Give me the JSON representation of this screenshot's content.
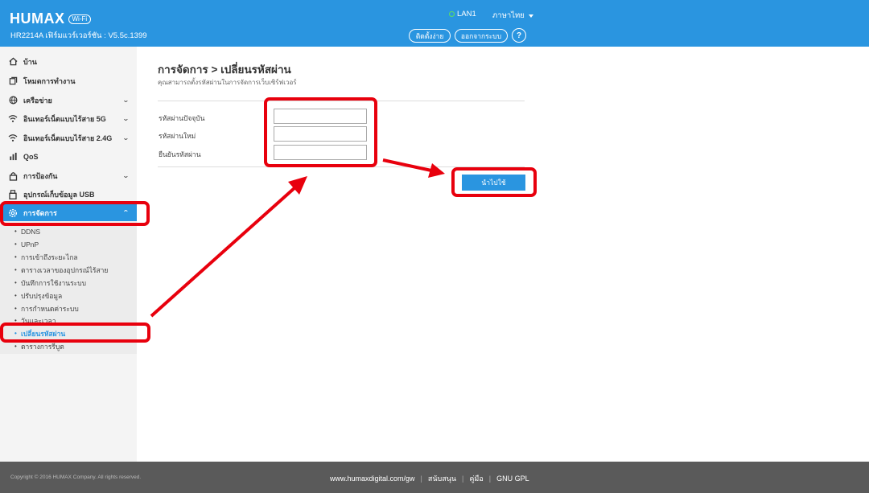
{
  "header": {
    "brand": "HUMAX",
    "wifi_badge": "Wi-Fi",
    "firmware": "HR2214A เฟิร์มแวร์เวอร์ชัน : V5.5c.1399",
    "lan_label": "LAN1",
    "language": "ภาษาไทย",
    "setup_button": "ติดตั้งง่าย",
    "logout_button": "ออกจากระบบ",
    "help_button": "?"
  },
  "sidebar": {
    "items": [
      {
        "label": "บ้าน",
        "icon": "home-icon"
      },
      {
        "label": "โหมดการทำงาน",
        "icon": "mode-icon"
      },
      {
        "label": "เครือข่าย",
        "icon": "globe-icon"
      },
      {
        "label": "อินเทอร์เน็ตแบบไร้สาย 5G",
        "icon": "wifi-icon"
      },
      {
        "label": "อินเทอร์เน็ตแบบไร้สาย 2.4G",
        "icon": "wifi-icon"
      },
      {
        "label": "QoS",
        "icon": "bar-chart-icon"
      },
      {
        "label": "การป้องกัน",
        "icon": "lock-icon"
      },
      {
        "label": "อุปกรณ์เก็บข้อมูล USB",
        "icon": "usb-icon"
      },
      {
        "label": "การจัดการ",
        "icon": "gear-icon"
      }
    ],
    "subitems": [
      "DDNS",
      "UPnP",
      "การเข้าถึงระยะไกล",
      "ตารางเวลาของอุปกรณ์ไร้สาย",
      "บันทึกการใช้งานระบบ",
      "ปรับปรุงข้อมูล",
      "การกำหนดค่าระบบ",
      "วันและเวลา",
      "เปลี่ยนรหัสผ่าน",
      "ตารางการรีบูต"
    ],
    "active_subitem_index": 8
  },
  "main": {
    "title": "การจัดการ > เปลี่ยนรหัสผ่าน",
    "subtitle": "คุณสามารถตั้งรหัสผ่านในการจัดการเว็บเซิร์ฟเวอร์",
    "fields": [
      {
        "label": "รหัสผ่านปัจจุบัน",
        "value": ""
      },
      {
        "label": "รหัสผ่านใหม่",
        "value": ""
      },
      {
        "label": "ยืนยันรหัสผ่าน",
        "value": ""
      }
    ],
    "apply_button": "นำไปใช้"
  },
  "footer": {
    "copyright": "Copyright © 2016 HUMAX Company. All rights reserved.",
    "links": [
      "www.humaxdigital.com/gw",
      "สนับสนุน",
      "คู่มือ",
      "GNU GPL"
    ]
  },
  "colors": {
    "accent": "#2a95e0",
    "annotation": "#e8000d",
    "footer_bg": "#5a5a5a",
    "lan_ok": "#5ee05e"
  }
}
